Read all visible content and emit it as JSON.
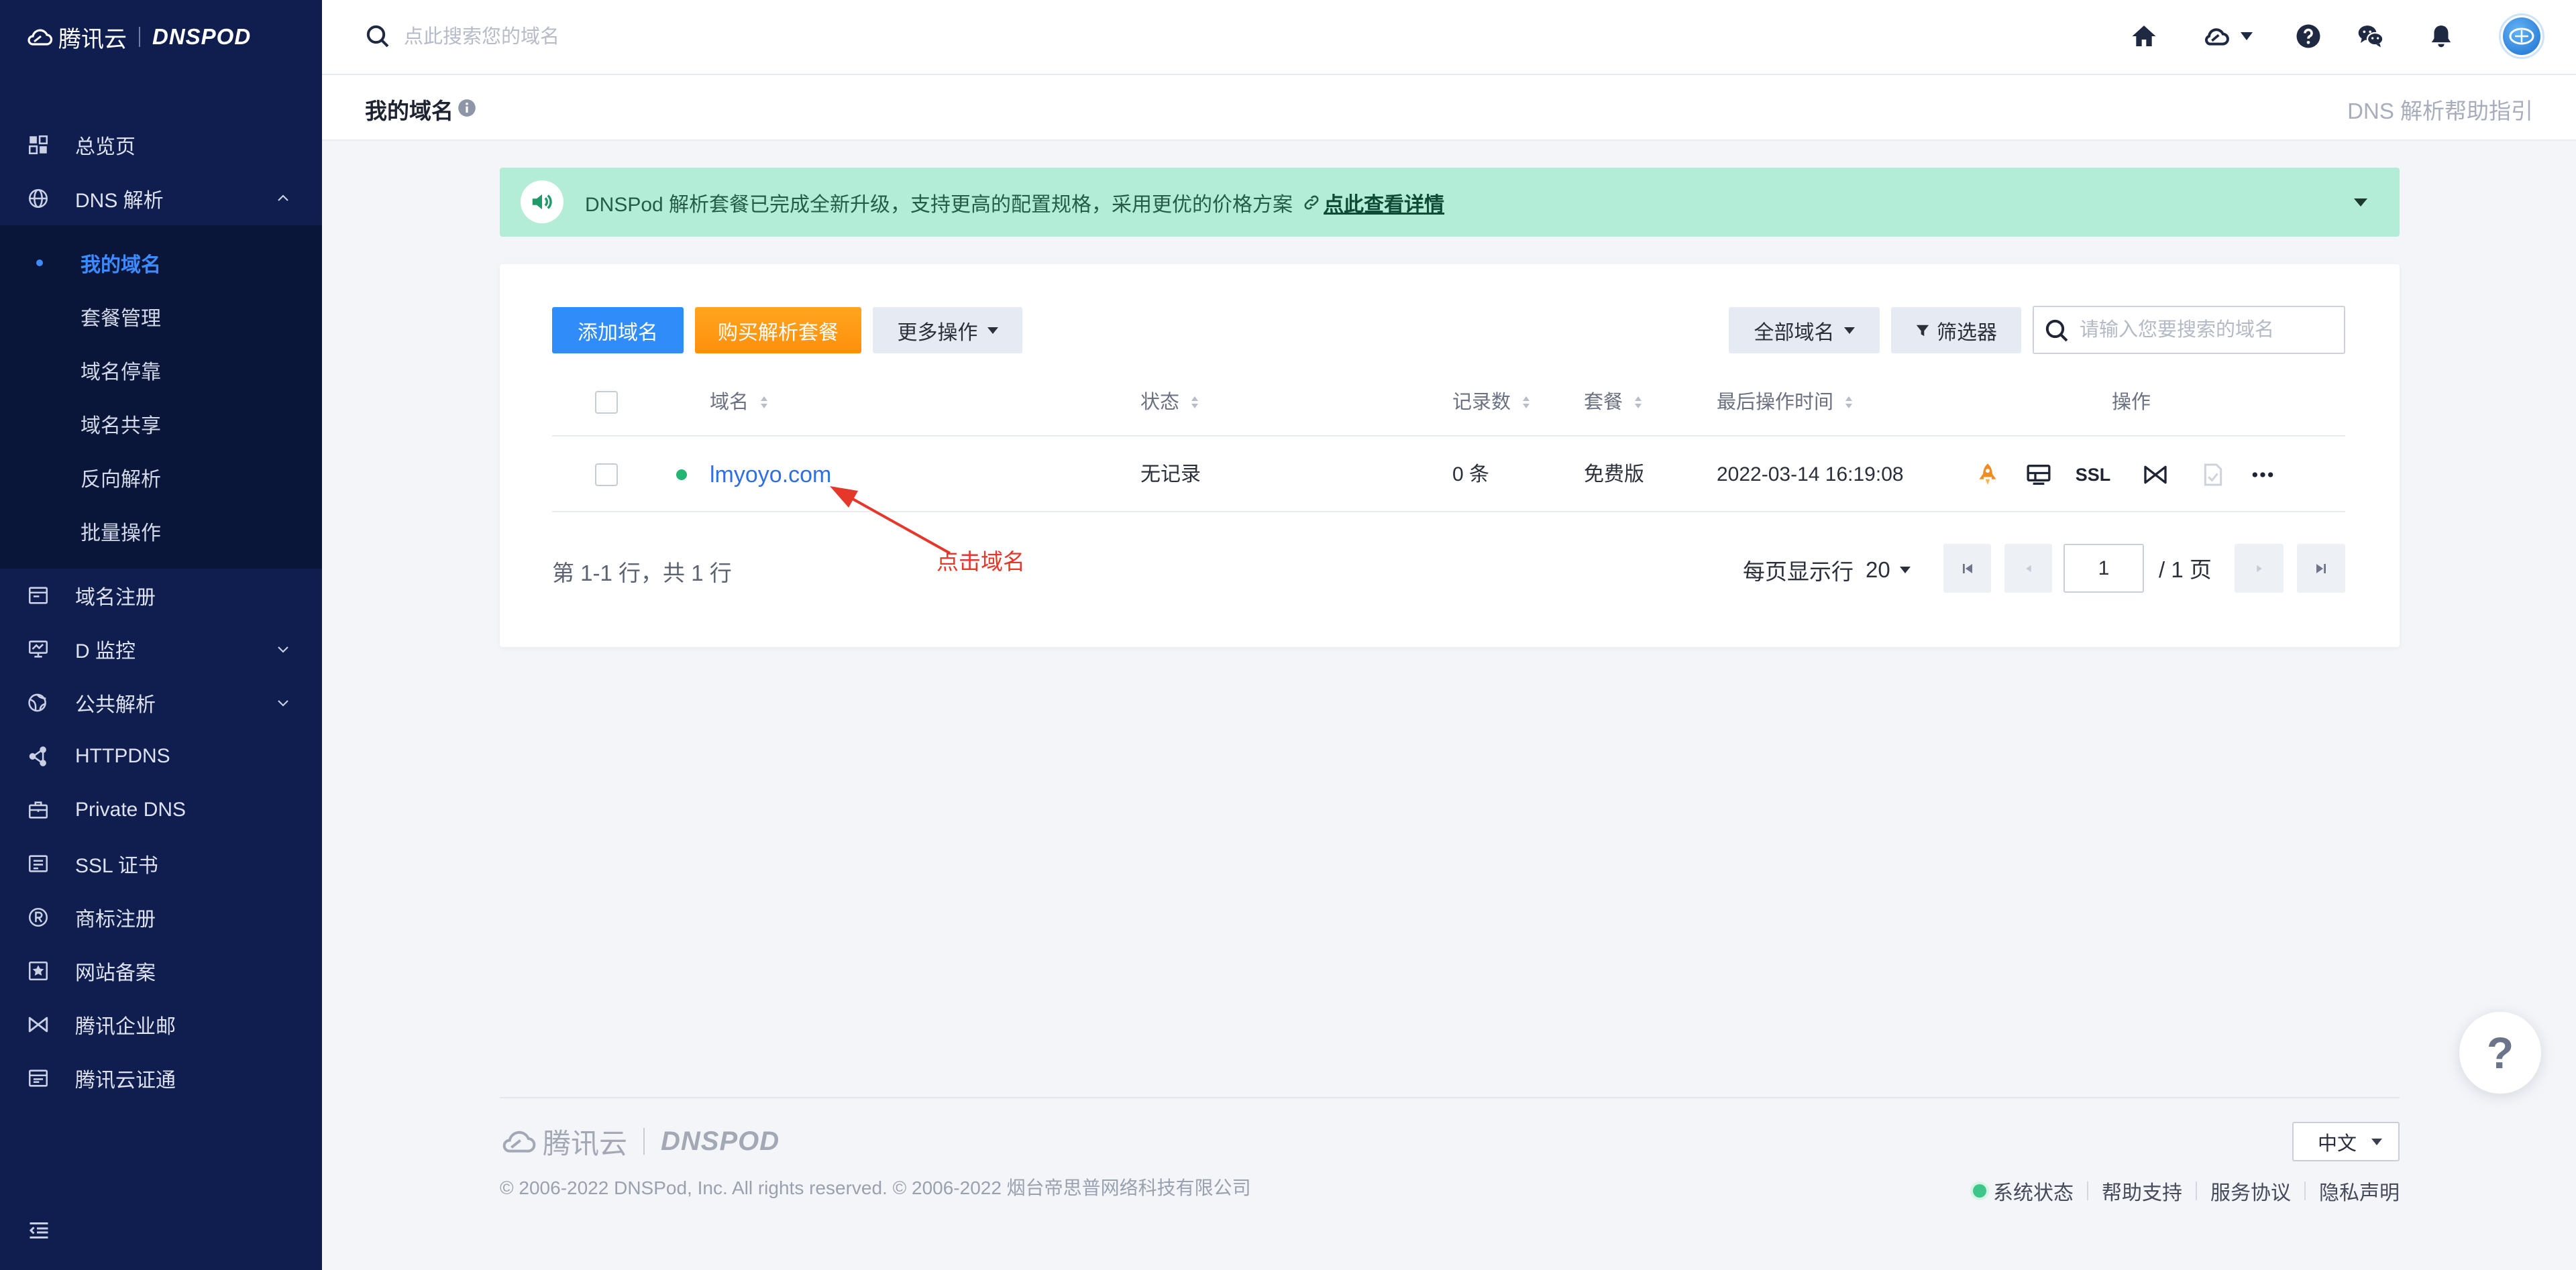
{
  "theme": {
    "sidebar_bg": "#0f1e4e",
    "submenu_bg": "#0a1639",
    "accent": "#2f8cf9",
    "buy_button": "#ff9a16",
    "banner_bg": "#b3edd8",
    "status_green": "#22b573",
    "annotation": "#e5382a"
  },
  "sidebar": {
    "brand": {
      "cloud": "腾讯云",
      "product": "DNSPOD"
    },
    "items": [
      {
        "label": "总览页",
        "icon": "dashboard-icon"
      },
      {
        "label": "DNS 解析",
        "icon": "globe-icon",
        "expanded": true
      },
      {
        "label": "域名注册",
        "icon": "browser-icon"
      },
      {
        "label": "D 监控",
        "icon": "monitor-icon",
        "expandable": true
      },
      {
        "label": "公共解析",
        "icon": "public-dns-icon",
        "expandable": true
      },
      {
        "label": "HTTPDNS",
        "icon": "nodes-icon"
      },
      {
        "label": "Private DNS",
        "icon": "briefcase-icon"
      },
      {
        "label": "SSL 证书",
        "icon": "certificate-icon"
      },
      {
        "label": "商标注册",
        "icon": "trademark-icon"
      },
      {
        "label": "网站备案",
        "icon": "record-icon"
      },
      {
        "label": "腾讯企业邮",
        "icon": "bowtie-icon"
      },
      {
        "label": "腾讯云证通",
        "icon": "id-card-icon"
      }
    ],
    "dns_submenu": [
      {
        "label": "我的域名",
        "active": true
      },
      {
        "label": "套餐管理"
      },
      {
        "label": "域名停靠"
      },
      {
        "label": "域名共享"
      },
      {
        "label": "反向解析"
      },
      {
        "label": "批量操作"
      }
    ],
    "collapse_icon": "collapse-menu-icon"
  },
  "header": {
    "search_placeholder": "点此搜索您的域名",
    "icons": [
      "home-icon",
      "cloud-icon",
      "help-icon",
      "wechat-icon",
      "bell-icon",
      "avatar"
    ]
  },
  "subheader": {
    "title": "我的域名",
    "help_link": "DNS 解析帮助指引"
  },
  "banner": {
    "message": "DNSPod 解析套餐已完成全新升级，支持更高的配置规格，采用更优的价格方案",
    "link": "点此查看详情"
  },
  "toolbar": {
    "add_domain": "添加域名",
    "buy_plan": "购买解析套餐",
    "more_actions": "更多操作",
    "domain_filter": "全部域名",
    "filter": "筛选器",
    "search_placeholder": "请输入您要搜索的域名"
  },
  "table": {
    "columns": [
      "域名",
      "状态",
      "记录数",
      "套餐",
      "最后操作时间",
      "操作"
    ],
    "rows": [
      {
        "domain": "lmyoyo.com",
        "status": "无记录",
        "records": "0 条",
        "plan": "免费版",
        "last_modified": "2022-03-14 16:19:08",
        "ssl_label": "SSL",
        "actions": [
          "rocket-icon",
          "monitor-icon",
          "ssl",
          "bowtie-icon",
          "document-icon",
          "more-icon"
        ]
      }
    ]
  },
  "pagination": {
    "summary": "第 1-1 行，共 1 行",
    "page_size_label": "每页显示行",
    "page_size": "20",
    "current_page": "1",
    "total_label": "/ 1 页"
  },
  "annotation": {
    "text": "点击域名"
  },
  "footer": {
    "brand_cloud": "腾讯云",
    "brand_product": "DNSPOD",
    "copyright": "© 2006-2022 DNSPod, Inc. All rights reserved. © 2006-2022 烟台帝思普网络科技有限公司",
    "language": "中文",
    "links": [
      "系统状态",
      "帮助支持",
      "服务协议",
      "隐私声明"
    ]
  },
  "help_button": {
    "label": "?"
  }
}
